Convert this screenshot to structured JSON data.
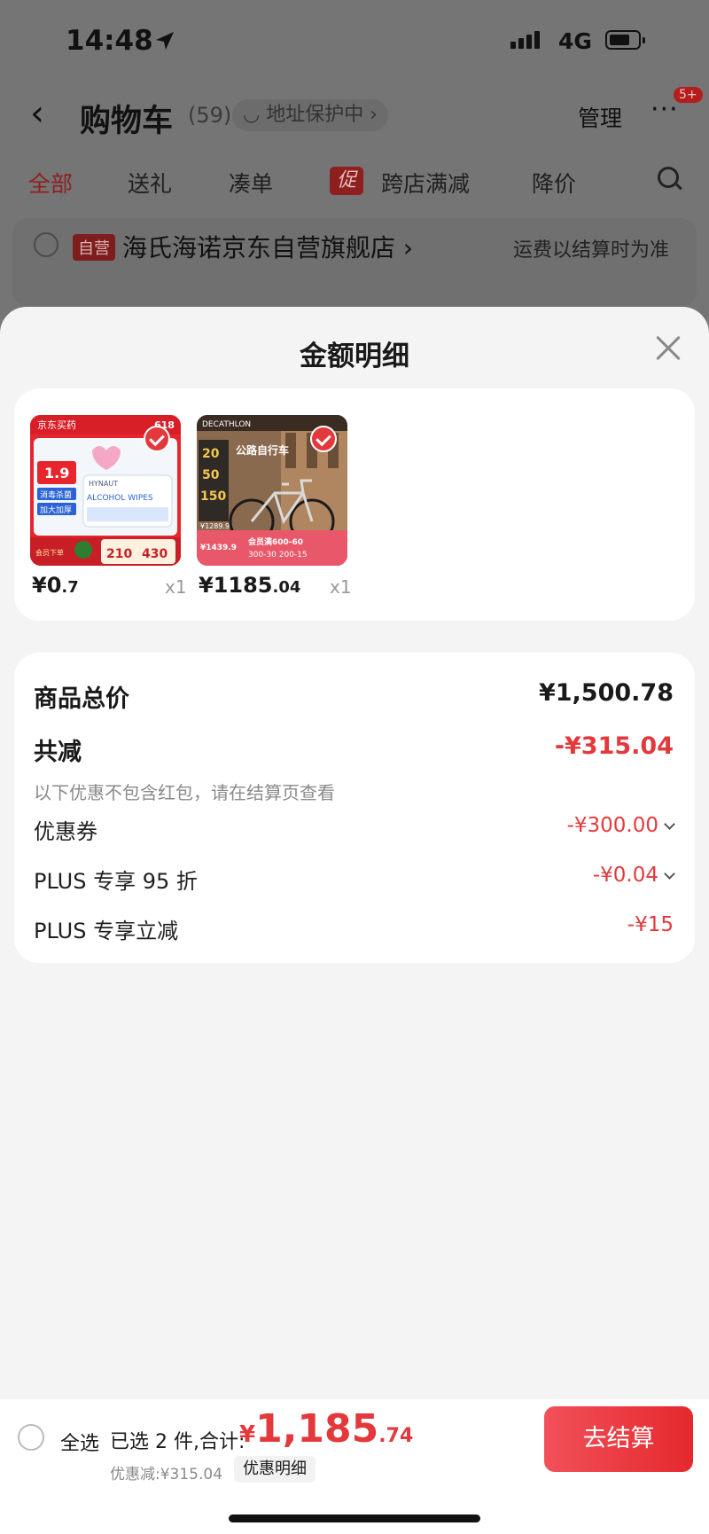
{
  "status_bar": {
    "time": "14:48",
    "network": "4G"
  },
  "nav": {
    "back": "‹",
    "title": "购物车",
    "count": "(59)",
    "address_pill": "◡ 地址保护中 ›",
    "manage": "管理",
    "more": "···",
    "more_badge": "5+"
  },
  "tabs": {
    "all": "全部",
    "gift": "送礼",
    "bundle": "凑单",
    "promo_tag": "促",
    "cross_store": "跨店满减",
    "price_drop": "降价"
  },
  "store": {
    "self_tag": "自营",
    "name": "海氏海诺京东自营旗舰店 ›",
    "shipping_note": "运费以结算时为准"
  },
  "sheet": {
    "title": "金额明细",
    "items": [
      {
        "price_main": "¥0",
        "price_dec": ".7",
        "qty": "x1",
        "thumb": {
          "logo": "京东买药",
          "tag": "618",
          "price": "1.9",
          "badge1": "消毒杀菌",
          "badge2": "加大加厚",
          "product": "ALCOHOL WIPES",
          "brand": "HYNAUT",
          "promo1": "210",
          "promo2": "430",
          "promo_label": "会员下单"
        }
      },
      {
        "price_main": "¥1185",
        "price_dec": ".04",
        "qty": "x1",
        "thumb": {
          "brand": "DECATHLON",
          "title": "公路自行车",
          "n1": "20",
          "n2": "50",
          "n3": "150",
          "price1": "¥1289.9",
          "price2": "¥1439.9",
          "promo": "会员满600-60",
          "promo2": "300-30 200-15"
        }
      }
    ],
    "goods_total_label": "商品总价",
    "goods_total_value": "¥1,500.78",
    "reduction_label": "共减",
    "reduction_value": "-¥315.04",
    "reduction_note": "以下优惠不包含红包，请在结算页查看",
    "discounts": [
      {
        "label": "优惠券",
        "value": "-¥300.00",
        "expandable": true
      },
      {
        "label": "PLUS 专享 95 折",
        "value": "-¥0.04",
        "expandable": true
      },
      {
        "label": "PLUS 专享立减",
        "value": "-¥15",
        "expandable": false
      }
    ]
  },
  "bottom": {
    "select_all": "全选",
    "selected_summary": "已选 2 件,合计:",
    "total_yen": "¥",
    "total_int": "1,185",
    "total_dec": ".74",
    "saved": "优惠减:¥315.04",
    "detail_button": "优惠明细",
    "checkout": "去结算"
  },
  "colors": {
    "accent": "#e4393c",
    "checkout_start": "#f2505a",
    "checkout_end": "#e4292d"
  }
}
